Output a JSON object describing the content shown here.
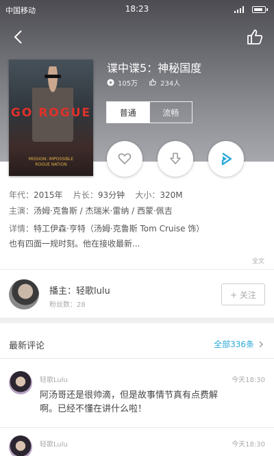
{
  "status_bar": {
    "carrier": "中国移动",
    "time": "18:23"
  },
  "movie": {
    "title": "谍中谍5：神秘国度",
    "plays": "105万",
    "likes": "234人",
    "poster_title": "GO ROGUE",
    "poster_subtitle": "MISSION: IMPOSSIBLE ROGUE NATION"
  },
  "quality": {
    "options": [
      "普通",
      "流畅"
    ],
    "selected": "普通"
  },
  "actions": {
    "favorite_icon": "heart-icon",
    "download_icon": "download-icon",
    "play_icon": "play-icon",
    "accent": "#2aa8d8"
  },
  "details": {
    "year_label": "年代：",
    "year": "2015年",
    "length_label": "片长：",
    "length": "93分钟",
    "size_label": "大小：",
    "size": "320M",
    "cast_label": "主演：",
    "cast": "汤姆·克鲁斯 / 杰瑞米·雷纳 / 西蒙·佩吉",
    "synopsis_label": "详情：",
    "synopsis_line1": "特工伊森·亨特（汤姆·克鲁斯 Tom Cruise 饰）",
    "synopsis_line2": "也有四面一规时刻。他在接收最新...",
    "more": "全文"
  },
  "streamer": {
    "label": "播主：轻歌lulu",
    "fans": "粉丝数：28",
    "follow": "+ 关注"
  },
  "comments": {
    "title": "最新评论",
    "all": "全部336条",
    "items": [
      {
        "name": "轻歌Lulu",
        "time": "今天18:30",
        "line1": "阿汤哥还是很帅滴，但是故事情节真有点费解",
        "line2": "啊。已经不懂在讲什么啦！"
      },
      {
        "name": "轻歌Lulu",
        "time": "今天18:30"
      }
    ]
  }
}
